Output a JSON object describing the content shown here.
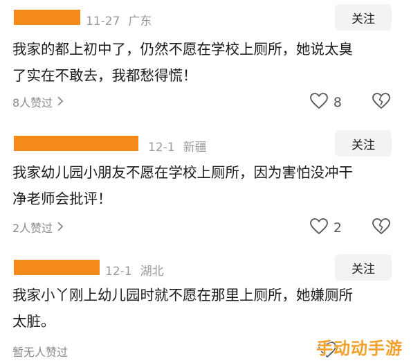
{
  "comments": [
    {
      "date": "11-27",
      "location": "广东",
      "follow_label": "关注",
      "text_line1": "我家的都上初中了，仍然不愿在学校上厕所，她说太臭",
      "text_line2": "了实在不敢去，我都愁得慌！",
      "likes_text": "8人赞过",
      "heart_count": "8"
    },
    {
      "date": "12-1",
      "location": "新疆",
      "follow_label": "关注",
      "text_line1": "我家幼儿园小朋友不愿在学校上厕所，因为害怕没冲干",
      "text_line2": "净老师会批评！",
      "likes_text": "2人赞过",
      "heart_count": "2"
    },
    {
      "date": "12-1",
      "location": "湖北",
      "follow_label": "关注",
      "text_line1": "我家小丫刚上幼儿园时就不愿在那里上厕所，她嫌厕所",
      "text_line2": "太脏。",
      "likes_text": "暂无人赞过",
      "heart_count": ""
    }
  ],
  "icons": {
    "heart": "heart-icon",
    "broken_heart": "broken-heart-icon",
    "chevron": "chevron-right-icon"
  },
  "colors": {
    "name_redaction": "#f48a1a",
    "watermark": "#f2a02a"
  },
  "watermark": "手动动手游"
}
